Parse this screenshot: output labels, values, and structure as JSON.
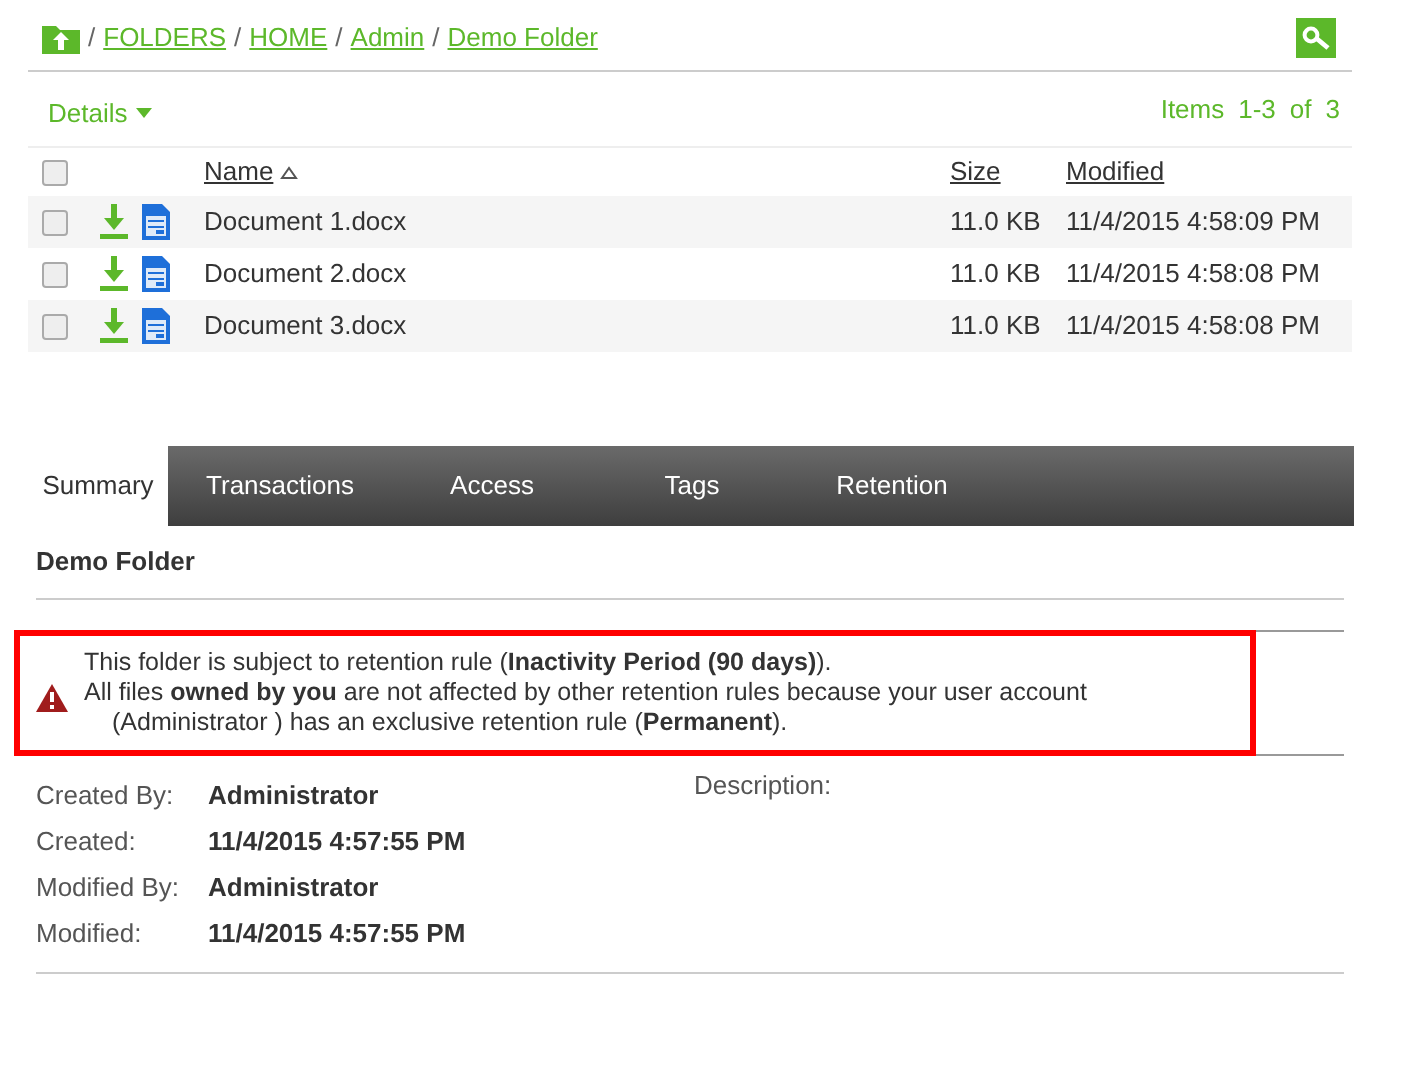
{
  "breadcrumb": [
    {
      "label": "FOLDERS"
    },
    {
      "label": "HOME"
    },
    {
      "label": "Admin"
    },
    {
      "label": "Demo Folder"
    }
  ],
  "separator": "/",
  "view_menu": {
    "label": "Details"
  },
  "items_count": {
    "label": "Items",
    "range": "1-3",
    "of": "of",
    "total": "3"
  },
  "table": {
    "select_all_checked": false,
    "columns": [
      {
        "label": "Name",
        "sorted": true
      },
      {
        "label": "Size",
        "sorted": false
      },
      {
        "label": "Modified",
        "sorted": false
      }
    ],
    "rows": [
      {
        "name": "Document 1.docx",
        "size": "11.0 KB",
        "modified": "11/4/2015 4:58:09 PM",
        "checked": false
      },
      {
        "name": "Document 2.docx",
        "size": "11.0 KB",
        "modified": "11/4/2015 4:58:08 PM",
        "checked": false
      },
      {
        "name": "Document 3.docx",
        "size": "11.0 KB",
        "modified": "11/4/2015 4:58:08 PM",
        "checked": false
      }
    ]
  },
  "tabs": [
    {
      "label": "Summary",
      "selected": true
    },
    {
      "label": "Transactions",
      "selected": false
    },
    {
      "label": "Access",
      "selected": false
    },
    {
      "label": "Tags",
      "selected": false
    },
    {
      "label": "Retention",
      "selected": false
    }
  ],
  "summary": {
    "title": "Demo Folder",
    "alert": {
      "lines": [
        "This folder is subject to retention rule (**Inactivity Period (90 days)**).",
        "All files **owned by you** are not affected by other retention rules because your user account",
        "(Administrator ) has an exclusive retention rule (**Permanent**)."
      ]
    },
    "fields": [
      {
        "label": "Created By:",
        "value": "Administrator"
      },
      {
        "label": "Created:",
        "value": "11/4/2015 4:57:55 PM"
      },
      {
        "label": "Modified By:",
        "value": "Administrator"
      },
      {
        "label": "Modified:",
        "value": "11/4/2015 4:57:55 PM"
      }
    ],
    "description_label": "Description:"
  }
}
